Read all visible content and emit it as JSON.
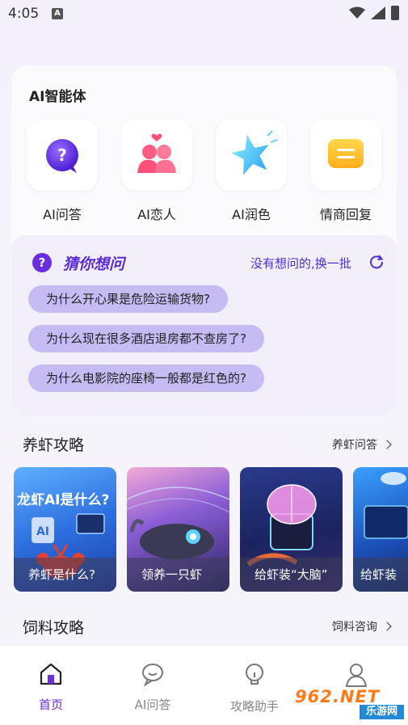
{
  "status": {
    "time": "4:05",
    "notif_letter": "A"
  },
  "agents": {
    "title": "AI智能体",
    "items": [
      {
        "label": "AI问答",
        "icon": "question-bubble-icon"
      },
      {
        "label": "AI恋人",
        "icon": "couple-icon"
      },
      {
        "label": "AI润色",
        "icon": "star-icon"
      },
      {
        "label": "情商回复",
        "icon": "chat-lines-icon"
      }
    ]
  },
  "guess": {
    "title": "猜你想问",
    "swap_label": "没有想问的,换一批",
    "questions": [
      "为什么开心果是危险运输货物?",
      "为什么现在很多酒店退房都不查房了?",
      "为什么电影院的座椅一般都是红色的?"
    ]
  },
  "shrimp": {
    "title": "养虾攻略",
    "more": "养虾问答",
    "cards": [
      {
        "headline": "龙虾AI是什么?",
        "caption": "养虾是什么?"
      },
      {
        "caption": "领养一只虾"
      },
      {
        "caption": "给虾装“大脑”"
      },
      {
        "caption": "给虾装"
      }
    ]
  },
  "feed": {
    "title": "饲料攻略",
    "more": "饲料咨询"
  },
  "tabs": [
    {
      "label": "首页",
      "icon": "home-icon"
    },
    {
      "label": "AI问答",
      "icon": "chat-icon"
    },
    {
      "label": "攻略助手",
      "icon": "lightbulb-icon"
    },
    {
      "label": "",
      "icon": "person-icon"
    }
  ],
  "watermark": {
    "brand": "962.NET",
    "sub": "乐游网"
  },
  "colors": {
    "accent": "#6a2de0",
    "pill": "#c7bbf4"
  }
}
